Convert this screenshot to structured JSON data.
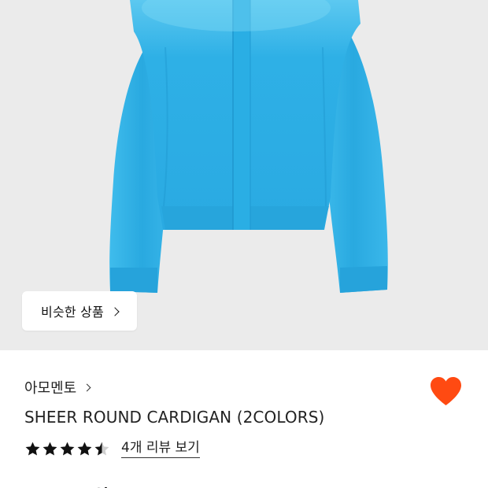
{
  "product_image": {
    "icon": "blue-cardigan-photo",
    "garment_color": "#2fb2e6",
    "background_color": "#ebebeb"
  },
  "similar_products_button": {
    "label": "비슷한 상품",
    "icon": "chevron-right-icon"
  },
  "product": {
    "brand": "아모멘토",
    "title": "SHEER ROUND CARDIGAN (2COLORS)",
    "rating": 4.5,
    "rating_max": 5,
    "review_link": "4개 리뷰 보기",
    "wishlisted": true,
    "wishlist_color": "#ff4a12",
    "price_peek": "원"
  }
}
